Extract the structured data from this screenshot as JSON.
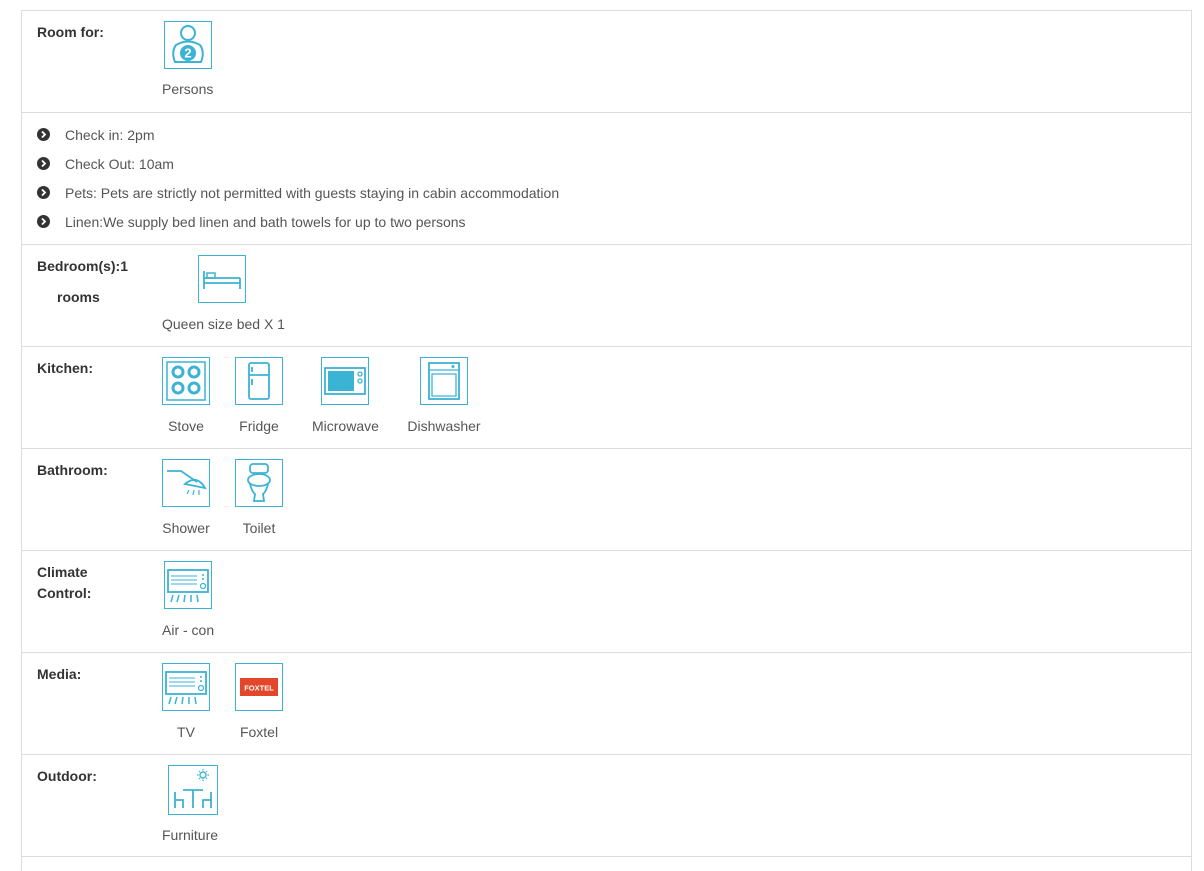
{
  "colors": {
    "icon_stroke": "#3bb3d4",
    "icon_fill": "#3bb3d4",
    "border": "#dcdcdc",
    "label": "#333333",
    "text": "#555555",
    "foxtel_red": "#e3472b"
  },
  "room_for": {
    "label": "Room for:",
    "icon": "person-2-icon",
    "caption": "Persons",
    "badge": "2"
  },
  "policies": [
    "Check in: 2pm",
    "Check Out: 10am",
    "Pets: Pets are strictly not permitted with guests staying in cabin accommodation",
    "Linen:We supply bed linen and bath towels for up to two persons"
  ],
  "bedrooms": {
    "label": "Bedroom(s):1",
    "label_sub": "rooms",
    "icon": "bed-icon",
    "caption": "Queen size bed X 1"
  },
  "kitchen": {
    "label": "Kitchen:",
    "items": [
      {
        "icon": "stove-icon",
        "caption": "Stove"
      },
      {
        "icon": "fridge-icon",
        "caption": "Fridge"
      },
      {
        "icon": "microwave-icon",
        "caption": "Microwave"
      },
      {
        "icon": "dishwasher-icon",
        "caption": "Dishwasher"
      }
    ]
  },
  "bathroom": {
    "label": "Bathroom:",
    "items": [
      {
        "icon": "shower-icon",
        "caption": "Shower"
      },
      {
        "icon": "toilet-icon",
        "caption": "Toilet"
      }
    ]
  },
  "climate": {
    "label": "Climate",
    "label_line2": "Control:",
    "items": [
      {
        "icon": "air-conditioner-icon",
        "caption": "Air - con"
      }
    ]
  },
  "media": {
    "label": "Media:",
    "items": [
      {
        "icon": "tv-icon",
        "caption": "TV"
      },
      {
        "icon": "foxtel-icon",
        "caption": "Foxtel",
        "logo_text": "FOXTEL"
      }
    ]
  },
  "outdoor": {
    "label": "Outdoor:",
    "items": [
      {
        "icon": "outdoor-furniture-icon",
        "caption": "Furniture"
      }
    ]
  }
}
